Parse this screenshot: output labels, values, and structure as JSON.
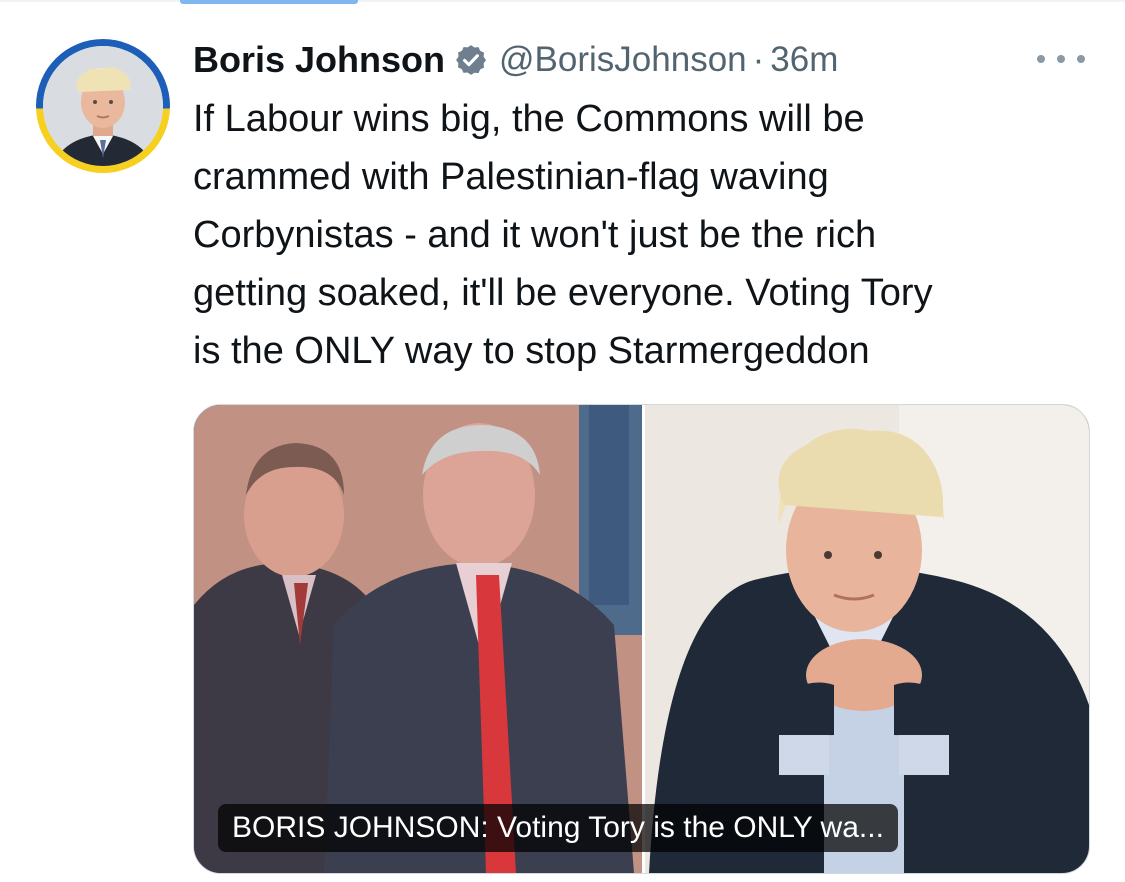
{
  "author": {
    "display_name": "Boris Johnson",
    "handle": "@BorisJohnson",
    "separator": "·",
    "time": "36m",
    "verified_icon": "verified-badge-icon",
    "verified_color": "#6f7f8f"
  },
  "tweet": {
    "lines": [
      "If Labour wins big, the Commons will be",
      "crammed with Palestinian-flag waving",
      "Corbynistas - and it won't just be the rich",
      "getting soaked, it'll be everyone. Voting Tory",
      "is the ONLY way to stop Starmergeddon"
    ]
  },
  "card": {
    "caption": "BORIS JOHNSON: Voting Tory is the ONLY wa..."
  },
  "colors": {
    "text_primary": "#0f1419",
    "text_secondary": "#536471",
    "avatar_ring_blue": "#1d5fb8",
    "avatar_ring_yellow": "#f6cf1f"
  }
}
